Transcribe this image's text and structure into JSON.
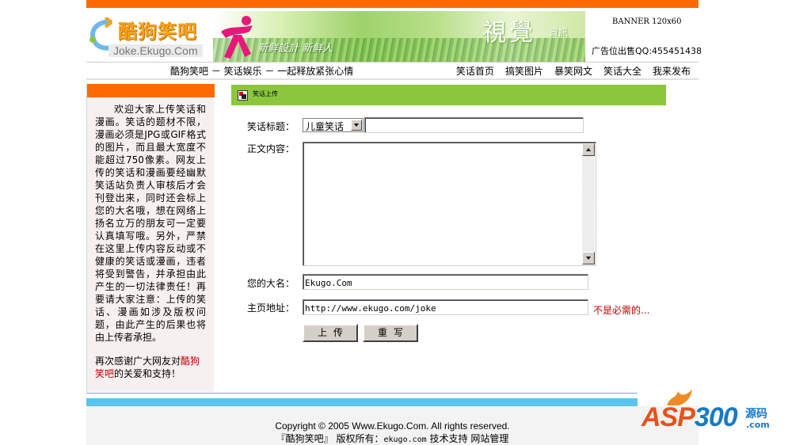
{
  "header": {
    "logo_title": "酷狗笑吧",
    "logo_url": "Joke.Ekugo.Com",
    "banner_text_left": "新鲜設計 新鲜人",
    "banner_text_big": "視覺",
    "banner_text_small": "資訊",
    "ad_banner": "BANNER 120x60",
    "ad_qq": "广告位出售QQ:455451438"
  },
  "nav": {
    "slogan": "酷狗笑吧 － 笑话娱乐 － 一起释放紧张心情",
    "links": [
      "笑话首页",
      "搞笑图片",
      "暴笑网文",
      "笑话大全",
      "我来发布"
    ]
  },
  "sidebar": {
    "notice": "欢迎大家上传笑话和漫画。笑话的题材不限，漫画必须是JPG或GIF格式的图片，而且最大宽度不能超过750像素。网友上传的笑话和漫画要经幽默笑话站负责人审核后才会刊登出来，同时还会标上您的大名哦，想在网络上扬名立万的朋友可一定要认真填写哦。另外，严禁在这里上传内容反动或不健康的笑话或漫画，违者将受到警告，并承担由此产生的一切法律责任！再要请大家注意：上传的笑话、漫画如涉及版权问题，由此产生的后果也将由上传者承担。",
    "thanks_prefix": "再次感谢广大网友对",
    "thanks_site": "酷狗笑吧",
    "thanks_suffix": "的关爱和支持！"
  },
  "section": {
    "title": "笑话上传"
  },
  "form": {
    "title_label": "笑话标题：",
    "category_selected": "儿童笑话",
    "title_value": "",
    "content_label": "正文内容：",
    "content_value": "",
    "name_label": "您的大名：",
    "name_value": "Ekugo.Com",
    "homepage_label": "主页地址：",
    "homepage_value": "http://www.ekugo.com/joke",
    "homepage_hint": "不是必需的...",
    "upload_button": "上传",
    "reset_button": "重写"
  },
  "footer": {
    "copyright": "Copyright © 2005 Www.Ekugo.Com. All rights reserved.",
    "site_name": "『酷狗笑吧』",
    "rights": "版权所有：",
    "domain": "ekugo.com",
    "support": "技术支持",
    "admin": "网站管理"
  },
  "watermark": {
    "brand_a": "ASP",
    "brand_b": "300",
    "brand_cn": "源码",
    "brand_com": ".com"
  },
  "colors": {
    "accent_orange": "#ff6a00",
    "section_green": "#8cc63f",
    "footer_blue": "#5bc3ef",
    "hint_red": "#c00000"
  }
}
